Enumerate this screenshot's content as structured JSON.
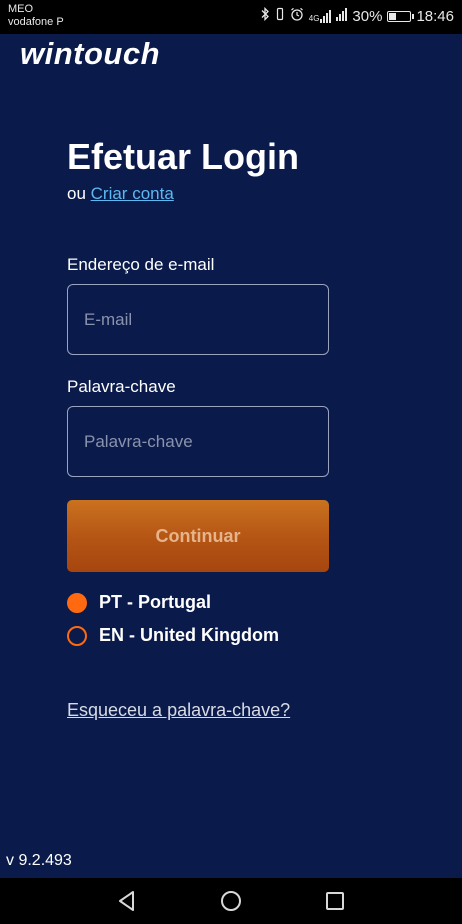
{
  "status_bar": {
    "carrier_1": "MEO",
    "carrier_2": "vodafone P",
    "network_label": "4G",
    "battery": "30%",
    "time": "18:46"
  },
  "logo": {
    "text": "wintouch"
  },
  "login": {
    "title": "Efetuar Login",
    "or_text": "ou ",
    "create_account": "Criar conta",
    "email_label": "Endereço de e-mail",
    "email_placeholder": "E-mail",
    "email_value": "",
    "password_label": "Palavra-chave",
    "password_placeholder": "Palavra-chave",
    "password_value": "",
    "continue_label": "Continuar",
    "forgot_password": "Esqueceu a palavra-chave?"
  },
  "languages": [
    {
      "label": "PT - Portugal",
      "selected": true
    },
    {
      "label": "EN - United Kingdom",
      "selected": false
    }
  ],
  "version": "v 9.2.493",
  "colors": {
    "background": "#0a1a4a",
    "accent": "#ff6a10",
    "link": "#5cb8f0",
    "button": "#b45414"
  },
  "icons": {
    "bluetooth": "bluetooth-icon",
    "vibrate": "vibrate-icon",
    "alarm": "alarm-icon",
    "back": "back-triangle-icon",
    "home": "home-circle-icon",
    "recent": "recent-square-icon"
  }
}
